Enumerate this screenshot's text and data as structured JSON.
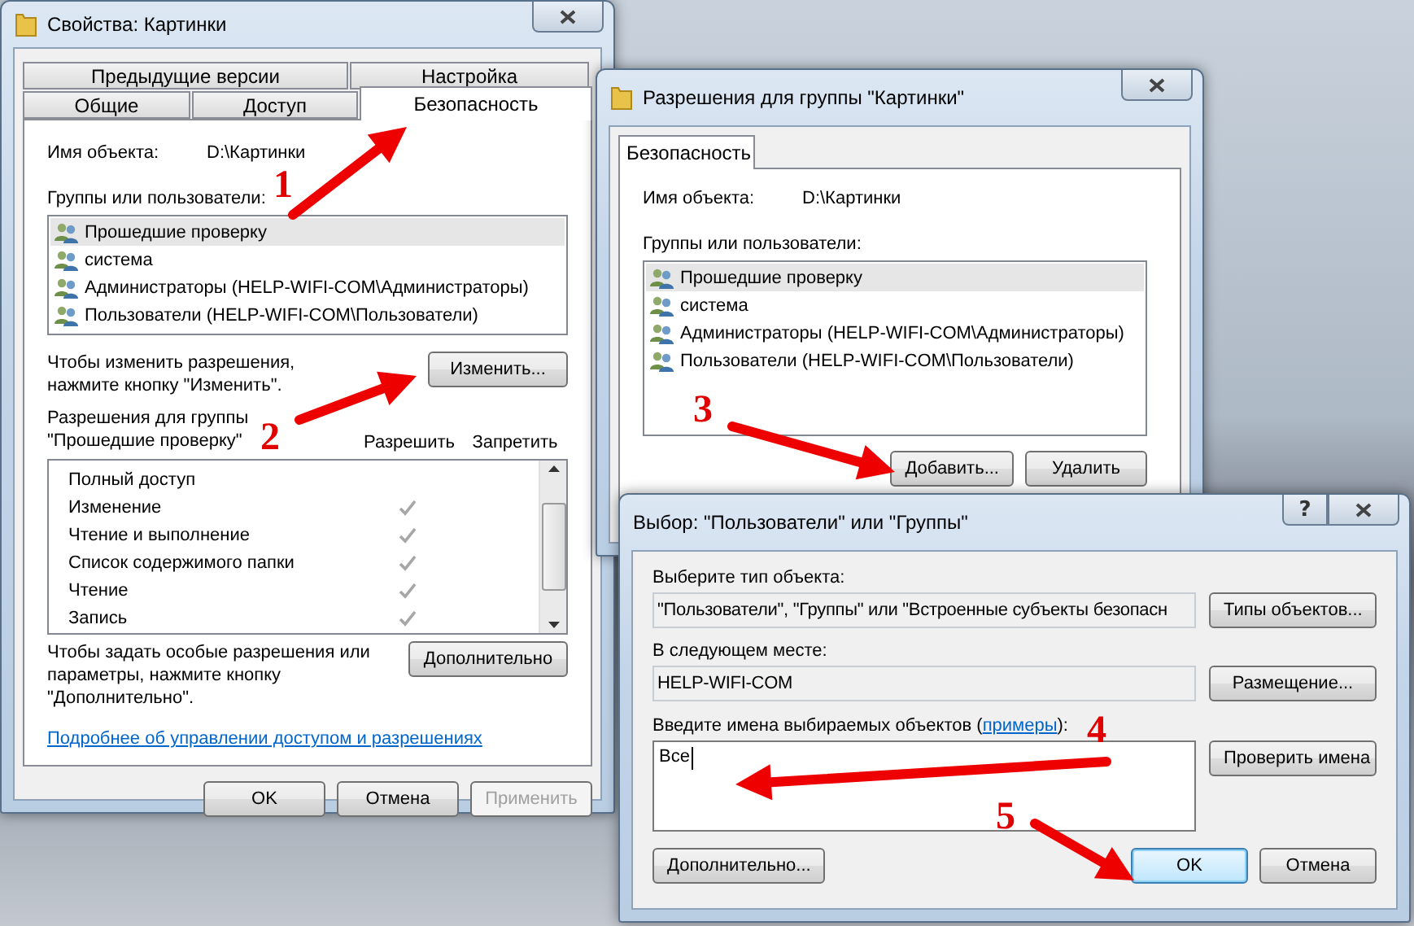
{
  "properties_window": {
    "title": "Свойства: Картинки",
    "tab_rows": [
      [
        {
          "label": "Предыдущие версии",
          "selected": false
        },
        {
          "label": "Настройка",
          "selected": false
        }
      ],
      [
        {
          "label": "Общие",
          "selected": false
        },
        {
          "label": "Доступ",
          "selected": false
        },
        {
          "label": "Безопасность",
          "selected": true
        }
      ]
    ],
    "object_name_label": "Имя объекта:",
    "object_name": "D:\\Картинки",
    "groups_label": "Группы или пользователи:",
    "groups": [
      {
        "name": "Прошедшие проверку",
        "selected": true
      },
      {
        "name": "система",
        "selected": false
      },
      {
        "name": "Администраторы (HELP-WIFI-COM\\Администраторы)",
        "selected": false
      },
      {
        "name": "Пользователи (HELP-WIFI-COM\\Пользователи)",
        "selected": false
      }
    ],
    "change_hint": "Чтобы изменить разрешения,\nнажмите кнопку \"Изменить\".",
    "change_button": "Изменить...",
    "permissions_label": "Разрешения для группы\n\"Прошедшие проверку\"",
    "columns": [
      "Разрешить",
      "Запретить"
    ],
    "permissions": [
      {
        "name": "Полный доступ",
        "allow": false,
        "deny": false
      },
      {
        "name": "Изменение",
        "allow": true,
        "deny": false
      },
      {
        "name": "Чтение и выполнение",
        "allow": true,
        "deny": false
      },
      {
        "name": "Список содержимого папки",
        "allow": true,
        "deny": false
      },
      {
        "name": "Чтение",
        "allow": true,
        "deny": false
      },
      {
        "name": "Запись",
        "allow": true,
        "deny": false
      }
    ],
    "advanced_hint": "Чтобы задать особые разрешения или\nпараметры, нажмите кнопку\n\"Дополнительно\".",
    "advanced_button": "Дополнительно",
    "help_link": "Подробнее об управлении доступом и разрешениях",
    "buttons": [
      {
        "label": "OK",
        "disabled": false
      },
      {
        "label": "Отмена",
        "disabled": false
      },
      {
        "label": "Применить",
        "disabled": true
      }
    ]
  },
  "permissions_window": {
    "title": "Разрешения для группы \"Картинки\"",
    "tabs": [
      {
        "label": "Безопасность",
        "selected": true
      }
    ],
    "object_name_label": "Имя объекта:",
    "object_name": "D:\\Картинки",
    "groups_label": "Группы или пользователи:",
    "groups": [
      {
        "name": "Прошедшие проверку",
        "selected": true
      },
      {
        "name": "система",
        "selected": false
      },
      {
        "name": "Администраторы (HELP-WIFI-COM\\Администраторы)",
        "selected": false
      },
      {
        "name": "Пользователи (HELP-WIFI-COM\\Пользователи)",
        "selected": false
      }
    ],
    "buttons": [
      "Добавить...",
      "Удалить"
    ]
  },
  "select_window": {
    "title": "Выбор: \"Пользователи\" или \"Группы\"",
    "help_button": "?",
    "object_type_label": "Выберите тип объекта:",
    "object_type_value": "\"Пользователи\", \"Группы\" или \"Встроенные субъекты безопасн",
    "object_types_button": "Типы объектов...",
    "location_label": "В следующем месте:",
    "location_value": "HELP-WIFI-COM",
    "location_button": "Размещение...",
    "names_label_before": "Введите имена выбираемых объектов (",
    "names_link": "примеры",
    "names_label_after": "):",
    "names_value": "Все",
    "check_names_button": "Проверить имена",
    "advanced_button": "Дополнительно...",
    "buttons": [
      {
        "label": "OK",
        "default": true
      },
      {
        "label": "Отмена",
        "default": false
      }
    ]
  },
  "annotations": [
    {
      "number": "1"
    },
    {
      "number": "2"
    },
    {
      "number": "3"
    },
    {
      "number": "4"
    },
    {
      "number": "5"
    }
  ]
}
